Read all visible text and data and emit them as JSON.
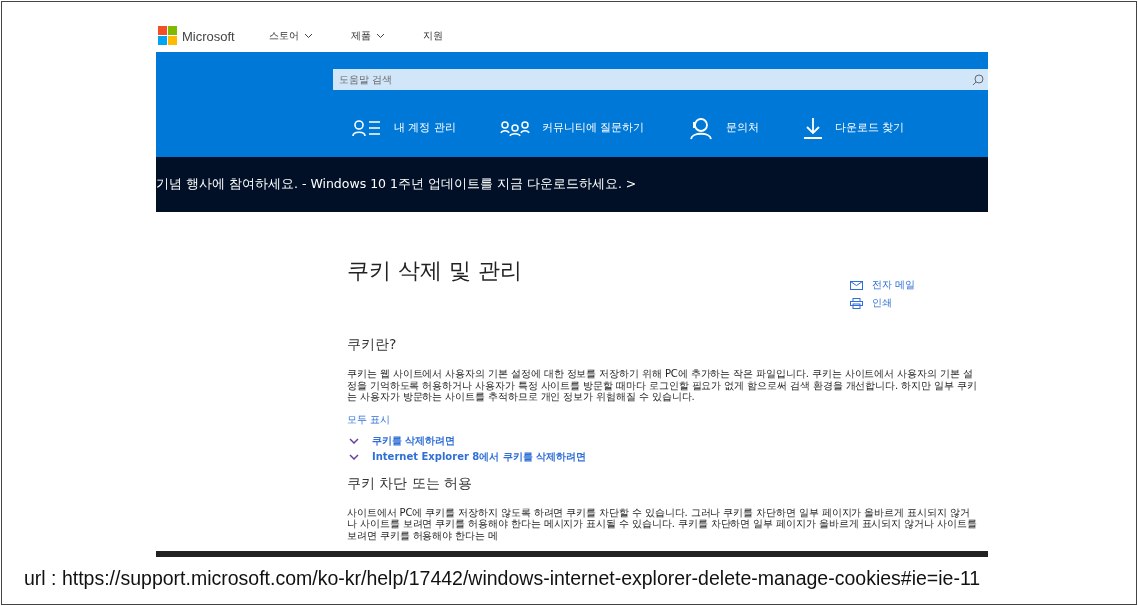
{
  "header": {
    "logo": "Microsoft",
    "menu": [
      {
        "label": "스토어",
        "dropdown": true
      },
      {
        "label": "제품",
        "dropdown": true
      },
      {
        "label": "지원",
        "dropdown": false
      }
    ]
  },
  "search": {
    "placeholder": "도움말 검색"
  },
  "quick_links": [
    {
      "kind": "account",
      "label": "내 계정 관리"
    },
    {
      "kind": "community",
      "label": "커뮤니티에 질문하기"
    },
    {
      "kind": "contact",
      "label": "문의처"
    },
    {
      "kind": "download",
      "label": "다운로드 찾기"
    }
  ],
  "banner": "기념 행사에 참여하세요. - Windows 10 1주년 업데이트를 지금 다운로드하세요. >",
  "article": {
    "title": "쿠키 삭제 및 관리",
    "share": [
      {
        "kind": "email",
        "label": "전자 메일"
      },
      {
        "kind": "print",
        "label": "인쇄"
      }
    ],
    "sections": [
      {
        "heading": "쿠키란?",
        "body": "쿠키는 웹 사이트에서 사용자의 기본 설정에 대한 정보를 저장하기 위해 PC에 추가하는 작은 파일입니다. 쿠키는 사이트에서 사용자의 기본 설정을 기억하도록 허용하거나 사용자가 특정 사이트를 방문할 때마다 로그인할 필요가 없게 함으로써 검색 환경을 개선합니다. 하지만 일부 쿠키는 사용자가 방문하는 사이트를 추적하므로 개인 정보가 위험해질 수 있습니다.",
        "show_all": "모두 표시",
        "expanders": [
          {
            "label": "쿠키를 삭제하려면",
            "expanded": false
          },
          {
            "label": "Internet Explorer 8에서 쿠키를 삭제하려면",
            "expanded": false
          }
        ]
      },
      {
        "heading": "쿠키 차단 또는 허용",
        "body": "사이트에서 PC에 쿠키를 저장하지 않도록 하려면 쿠키를 차단할 수 있습니다. 그러나 쿠키를 차단하면 일부 페이지가 올바르게 표시되지 않거나 사이트를 보려면 쿠키를 허용해야 한다는 메시지가 표시될 수 있습니다. 쿠키를 차단하면 일부 페이지가 올바르게 표시되지 않거나 사이트를 보려면 쿠키를 허용해야 한다는 메"
      }
    ]
  },
  "caption": "url : https://support.microsoft.com/ko-kr/help/17442/windows-internet-explorer-delete-manage-cookies#ie=ie-11"
}
